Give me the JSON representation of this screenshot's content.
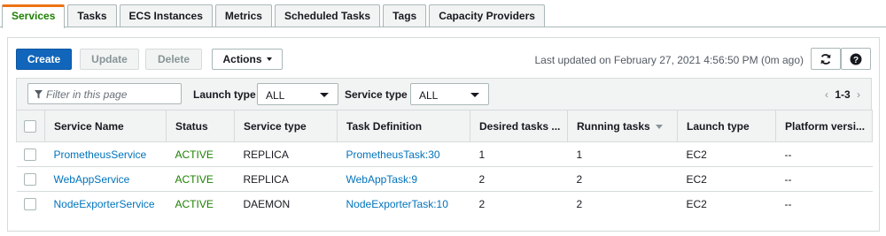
{
  "tabs": [
    "Services",
    "Tasks",
    "ECS Instances",
    "Metrics",
    "Scheduled Tasks",
    "Tags",
    "Capacity Providers"
  ],
  "toolbar": {
    "create_label": "Create",
    "update_label": "Update",
    "delete_label": "Delete",
    "actions_label": "Actions",
    "last_updated": "Last updated on February 27, 2021 4:56:50 PM (0m ago)"
  },
  "filters": {
    "search_placeholder": "Filter in this page",
    "launch_type_label": "Launch type",
    "launch_type_value": "ALL",
    "service_type_label": "Service type",
    "service_type_value": "ALL",
    "pagination": "1-3"
  },
  "table": {
    "columns": [
      "Service Name",
      "Status",
      "Service type",
      "Task Definition",
      "Desired tasks ...",
      "Running tasks",
      "Launch type",
      "Platform versi..."
    ],
    "rows": [
      {
        "name": "PrometheusService",
        "status": "ACTIVE",
        "type": "REPLICA",
        "task_def": "PrometheusTask:30",
        "desired": "1",
        "running": "1",
        "launch": "EC2",
        "platform": "--"
      },
      {
        "name": "WebAppService",
        "status": "ACTIVE",
        "type": "REPLICA",
        "task_def": "WebAppTask:9",
        "desired": "2",
        "running": "2",
        "launch": "EC2",
        "platform": "--"
      },
      {
        "name": "NodeExporterService",
        "status": "ACTIVE",
        "type": "DAEMON",
        "task_def": "NodeExporterTask:10",
        "desired": "2",
        "running": "2",
        "launch": "EC2",
        "platform": "--"
      }
    ]
  },
  "icons": {
    "refresh": "refresh-icon",
    "help": "help-icon",
    "filter": "filter-icon"
  },
  "colors": {
    "primary": "#1166bb",
    "tab_accent": "#ec7211",
    "link": "#0073bb",
    "status_active": "#1d8102"
  }
}
